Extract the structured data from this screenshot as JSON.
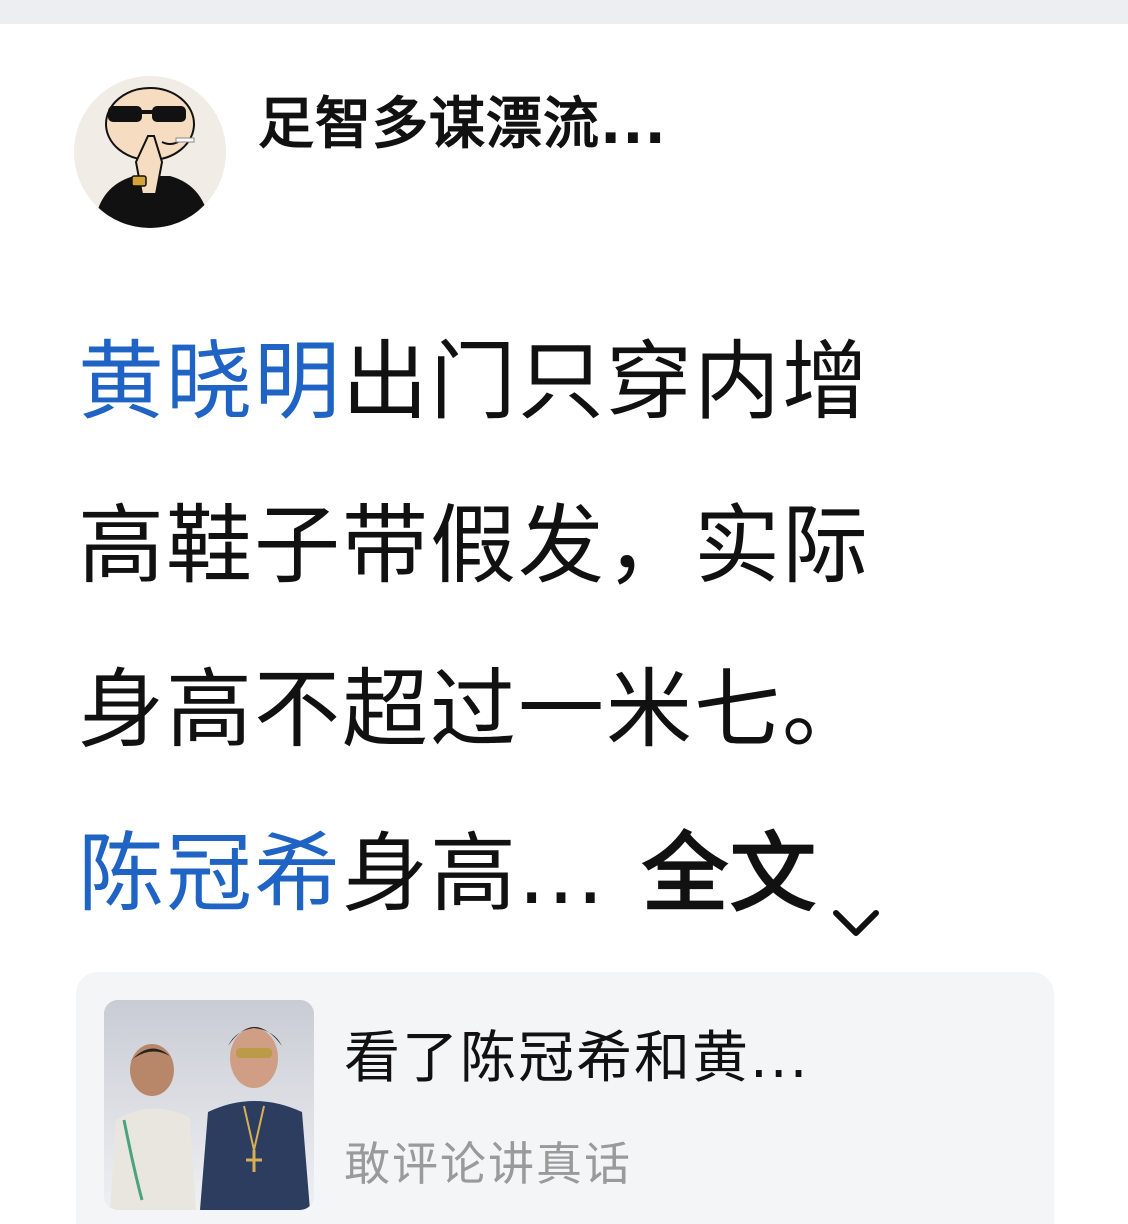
{
  "author": {
    "name": "足智多谋漂流...",
    "avatar_icon": "cartoon-avatar-icon"
  },
  "post": {
    "lines": [
      {
        "mention": "黄晓明",
        "text": "出门只穿内增"
      },
      {
        "text": "高鞋子带假发，实际"
      },
      {
        "text": "身高不超过一米七。"
      },
      {
        "mention": "陈冠希",
        "text": "身高..."
      }
    ],
    "read_more_label": "全文",
    "read_more_icon": "chevron-down-icon"
  },
  "link_card": {
    "title": "看了陈冠希和黄...",
    "source": "敢评论讲真话",
    "thumbnail_icon": "photo-thumbnail"
  },
  "colors": {
    "mention": "#1f63c4",
    "text": "#111111",
    "muted": "#9a9a9a",
    "card_bg": "#f4f5f7"
  }
}
